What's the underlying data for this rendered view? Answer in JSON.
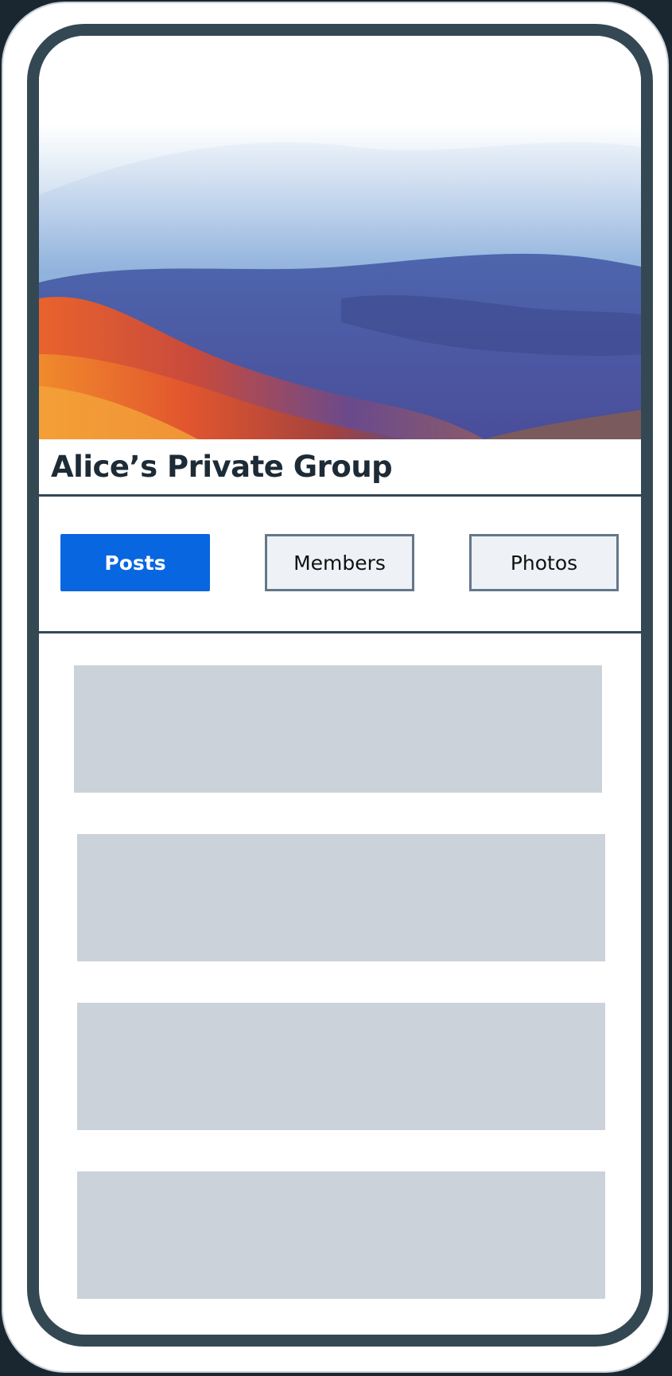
{
  "group": {
    "title": "Alice’s Private Group"
  },
  "tabs": [
    {
      "label": "Posts",
      "active": true
    },
    {
      "label": "Members",
      "active": false
    },
    {
      "label": "Photos",
      "active": false
    }
  ],
  "feed": {
    "placeholder_count": 4
  },
  "colors": {
    "frame": "#344854",
    "tab_active": "#0866e0",
    "tab_inactive_bg": "#eef2f6",
    "tab_inactive_border": "#657789",
    "placeholder": "#cbd2d9",
    "title_text": "#1d2b36"
  }
}
